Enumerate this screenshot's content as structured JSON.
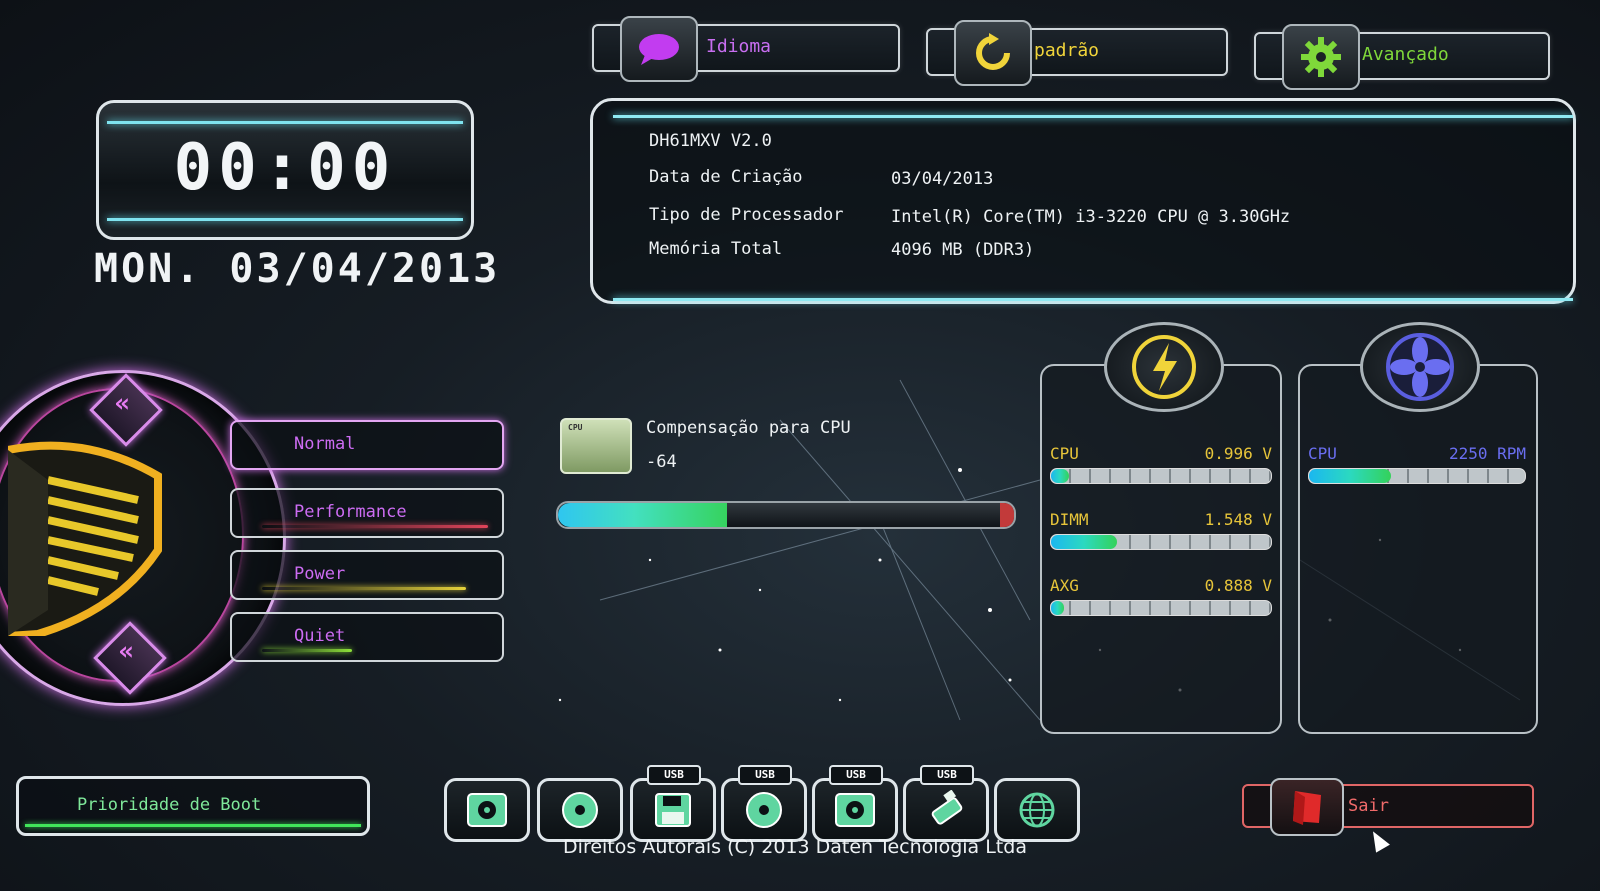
{
  "top_buttons": {
    "language": {
      "label": "Idioma",
      "icon": "speech-bubble-icon"
    },
    "default": {
      "label": "padrão",
      "icon": "refresh-icon"
    },
    "advanced": {
      "label": "Avançado",
      "icon": "gear-icon"
    }
  },
  "clock": {
    "time": "00:00",
    "date": "MON. 03/04/2013"
  },
  "system_info": {
    "board": "DH61MXV V2.0",
    "build_date_label": "Data de Criação",
    "build_date": "03/04/2013",
    "processor_label": "Tipo de Processador",
    "processor": "Intel(R) Core(TM) i3-3220 CPU @ 3.30GHz",
    "memory_label": "Memória Total",
    "memory": "4096 MB (DDR3)"
  },
  "profiles": {
    "items": [
      {
        "label": "Normal",
        "color": "#cc6cf2"
      },
      {
        "label": "Performance",
        "color": "#e0445a"
      },
      {
        "label": "Power",
        "color": "#e6d23a"
      },
      {
        "label": "Quiet",
        "color": "#8ee03a"
      }
    ],
    "selected": "Normal"
  },
  "cpu_offset": {
    "label": "Compensação para CPU",
    "value": "-64",
    "chip_text": "CPU",
    "level": 0.37
  },
  "voltage": {
    "icon": "lightning-icon",
    "rows": [
      {
        "name": "CPU",
        "value": "0.996 V",
        "level": 0.08
      },
      {
        "name": "DIMM",
        "value": "1.548 V",
        "level": 0.3
      },
      {
        "name": "AXG",
        "value": "0.888 V",
        "level": 0.06
      }
    ]
  },
  "fan": {
    "icon": "fan-icon",
    "rows": [
      {
        "name": "CPU",
        "value": "2250 RPM",
        "level": 0.38
      }
    ]
  },
  "boot": {
    "label": "Prioridade de Boot",
    "devices": [
      {
        "icon": "hard-disk-icon",
        "tag": ""
      },
      {
        "icon": "optical-disc-icon",
        "tag": ""
      },
      {
        "icon": "usb-floppy-icon",
        "tag": "USB"
      },
      {
        "icon": "usb-cd-icon",
        "tag": "USB"
      },
      {
        "icon": "usb-hdd-icon",
        "tag": "USB"
      },
      {
        "icon": "usb-stick-icon",
        "tag": "USB"
      },
      {
        "icon": "network-globe-icon",
        "tag": ""
      }
    ]
  },
  "exit": {
    "label": "Sair",
    "icon": "exit-door-icon"
  },
  "copyright": "Direitos Autorais (C) 2013 Daten Tecnologia Ltda",
  "colors": {
    "accent_cyan": "#7fe3ef",
    "accent_purple": "#cc6cf2",
    "accent_yellow": "#e7c53a",
    "accent_green": "#41e55a",
    "accent_red": "#e06666"
  }
}
